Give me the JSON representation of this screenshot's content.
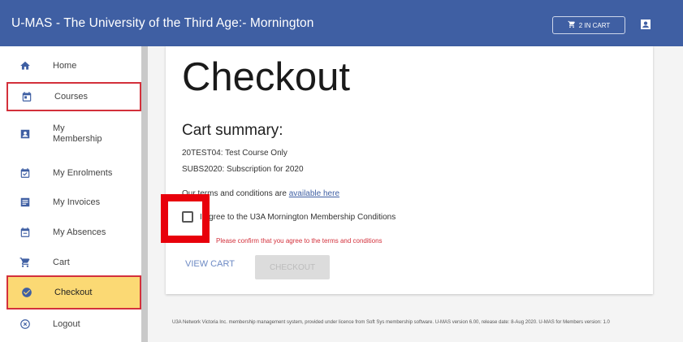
{
  "app": {
    "title": "U-MAS - The University of the Third Age:- Mornington",
    "cart_button": "2 IN CART"
  },
  "sidebar": {
    "items": [
      {
        "label": "Home",
        "icon": "home-icon"
      },
      {
        "label": "Courses",
        "icon": "calendar-icon"
      },
      {
        "label": "My Membership",
        "icon": "badge-icon"
      },
      {
        "label": "My Enrolments",
        "icon": "checkbox-calendar-icon"
      },
      {
        "label": "My Invoices",
        "icon": "invoice-icon"
      },
      {
        "label": "My Absences",
        "icon": "calendar-minus-icon"
      },
      {
        "label": "Cart",
        "icon": "cart-icon"
      },
      {
        "label": "Checkout",
        "icon": "check-circle-icon"
      },
      {
        "label": "Logout",
        "icon": "logout-icon"
      }
    ]
  },
  "main": {
    "title": "Checkout",
    "cart_summary_heading": "Cart summary:",
    "cart_lines": [
      "20TEST04: Test Course Only",
      "SUBS2020: Subscription for 2020"
    ],
    "terms_text": "Our terms and conditions are",
    "terms_link": "available here",
    "agree_label": "I agree to the U3A Mornington Membership Conditions",
    "error_text": "Please confirm that you agree to the terms and conditions",
    "view_cart_label": "VIEW CART",
    "checkout_label": "CHECKOUT"
  },
  "footer": {
    "text": "U3A Network Victoria Inc. membership management system, provided under licence from Soft Sys membership software. U-MAS version 6.00, release date: 8-Aug 2020. U-MAS for Members version: 1.0"
  },
  "colors": {
    "header": "#3f5fa3",
    "active_item": "#fbd974",
    "highlight": "#d3303b",
    "annotation": "#e8000b"
  }
}
